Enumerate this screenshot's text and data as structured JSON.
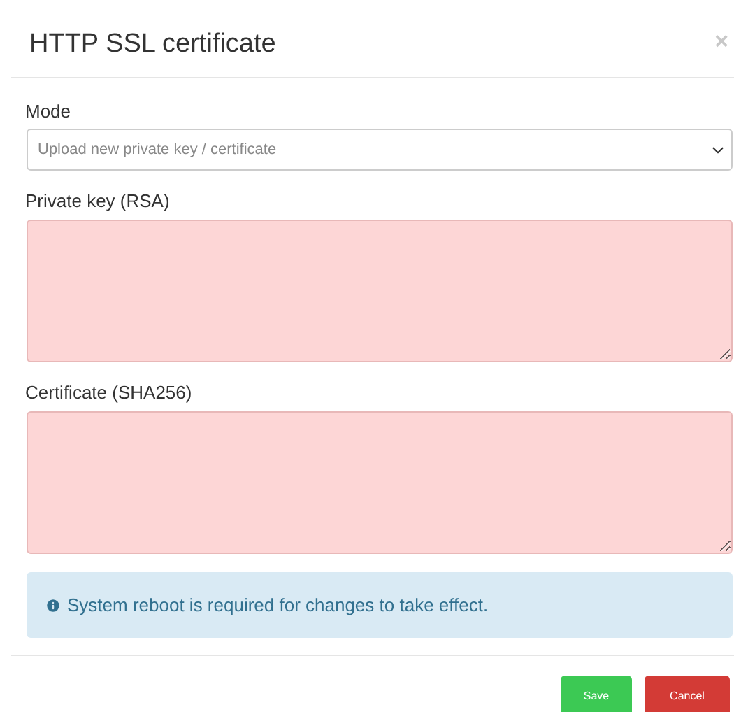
{
  "dialog": {
    "title": "HTTP SSL certificate",
    "close": "×"
  },
  "mode": {
    "label": "Mode",
    "value": "Upload new private key / certificate"
  },
  "fields": [
    {
      "label": "Private key (RSA)",
      "invalid": true
    },
    {
      "label": "Certificate (SHA256)",
      "invalid": true
    }
  ],
  "alert": {
    "text": "System reboot is required for changes to take effect."
  },
  "buttons": [
    {
      "label": "Save",
      "kind": "save"
    },
    {
      "label": "Cancel",
      "kind": "cancel"
    }
  ]
}
